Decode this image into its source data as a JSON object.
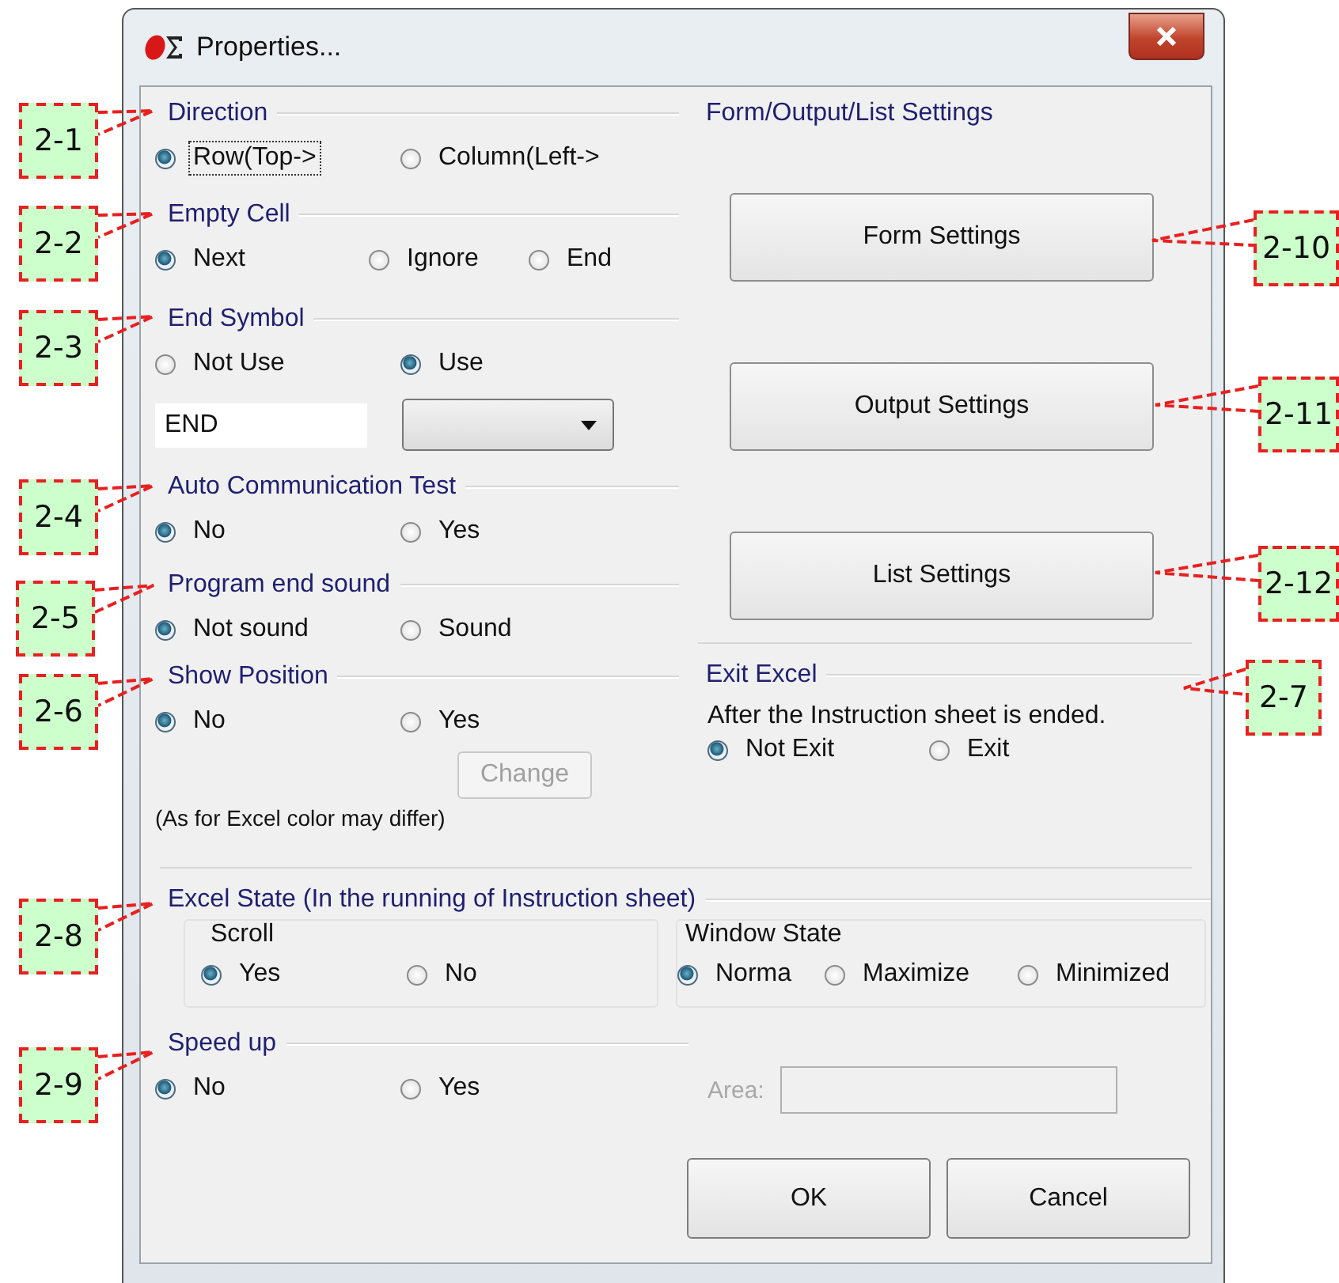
{
  "window": {
    "title": "Properties..."
  },
  "left_sections": [
    {
      "title": "Direction",
      "options": [
        {
          "label": "Row(Top->",
          "selected": true,
          "focused": true
        },
        {
          "label": "Column(Left->",
          "selected": false,
          "focused": false
        }
      ]
    },
    {
      "title": "Empty Cell",
      "options": [
        {
          "label": "Next",
          "selected": true,
          "focused": false
        },
        {
          "label": "Ignore",
          "selected": false,
          "focused": false
        },
        {
          "label": "End",
          "selected": false,
          "focused": false
        }
      ]
    },
    {
      "title": "End Symbol",
      "options": [
        {
          "label": "Not Use",
          "selected": false,
          "focused": false
        },
        {
          "label": "Use",
          "selected": true,
          "focused": false
        }
      ],
      "field": {
        "value": "END"
      }
    },
    {
      "title": "Auto Communication Test",
      "options": [
        {
          "label": "No",
          "selected": true,
          "focused": false
        },
        {
          "label": "Yes",
          "selected": false,
          "focused": false
        }
      ]
    },
    {
      "title": "Program end sound",
      "options": [
        {
          "label": "Not sound",
          "selected": true,
          "focused": false
        },
        {
          "label": "Sound",
          "selected": false,
          "focused": false
        }
      ]
    },
    {
      "title": "Show Position",
      "options": [
        {
          "label": "No",
          "selected": true,
          "focused": false
        },
        {
          "label": "Yes",
          "selected": false,
          "focused": false
        }
      ],
      "button": {
        "label": "Change",
        "disabled": true
      },
      "note": "(As for Excel color may differ)"
    }
  ],
  "settings_group": {
    "title": "Form/Output/List Settings",
    "buttons": [
      "Form Settings",
      "Output Settings",
      "List Settings"
    ]
  },
  "exit_excel": {
    "title": "Exit Excel",
    "description": "After the Instruction sheet is ended.",
    "options": [
      {
        "label": "Not Exit",
        "selected": true,
        "focused": false
      },
      {
        "label": "Exit",
        "selected": false,
        "focused": false
      }
    ]
  },
  "excel_state": {
    "title": "Excel State (In the running of Instruction sheet)",
    "groups": [
      {
        "title": "Scroll",
        "options": [
          {
            "label": "Yes",
            "selected": true,
            "focused": false
          },
          {
            "label": "No",
            "selected": false,
            "focused": false
          }
        ]
      },
      {
        "title": "Window State",
        "options": [
          {
            "label": "Norma",
            "selected": true,
            "focused": false
          },
          {
            "label": "Maximize",
            "selected": false,
            "focused": false
          },
          {
            "label": "Minimized",
            "selected": false,
            "focused": false
          }
        ]
      }
    ]
  },
  "speed_up": {
    "title": "Speed up",
    "options": [
      {
        "label": "No",
        "selected": true,
        "focused": false
      },
      {
        "label": "Yes",
        "selected": false,
        "focused": false
      }
    ],
    "area": {
      "label": "Area:",
      "disabled": true
    }
  },
  "buttons": [
    "OK",
    "Cancel"
  ],
  "callouts": [
    "2-1",
    "2-2",
    "2-3",
    "2-4",
    "2-5",
    "2-6",
    "2-8",
    "2-9",
    "2-10",
    "2-11",
    "2-12",
    "2-7"
  ]
}
